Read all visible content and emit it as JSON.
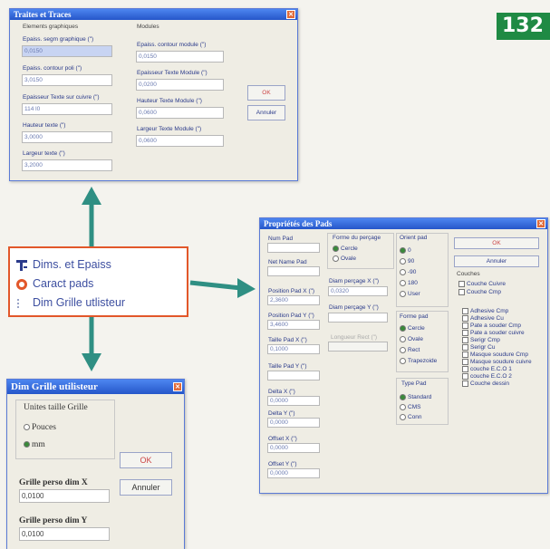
{
  "page_number": "132",
  "colors": {
    "arrow": "#2f8f83",
    "menu_border": "#e2572a",
    "accent_green": "#1f8a44",
    "title_blue": "#2b5fd6"
  },
  "menu": {
    "items": [
      {
        "icon": "tool-icon",
        "label": "Dims. et Epaiss"
      },
      {
        "icon": "target-icon",
        "label": "Caract pads"
      },
      {
        "icon": "grid-icon",
        "label": "Dim Grille utlisteur"
      }
    ]
  },
  "win_epaisseurs": {
    "title": "Traites et Traces",
    "group_left": "Elements graphiques",
    "group_right": "Modules",
    "fields_left": [
      {
        "label": "Epaiss. segm graphique (\")",
        "value": "0,0150"
      },
      {
        "label": "Epaiss. contour poli (\")",
        "value": "3,0150"
      },
      {
        "label": "Epaisseur Texte sur cuivre (\")",
        "value": "114 l0"
      },
      {
        "label": "Hauteur texte (\")",
        "value": "3,0000"
      },
      {
        "label": "Largeur texte (\")",
        "value": "3,2000"
      }
    ],
    "fields_right": [
      {
        "label": "Epaiss. contour module (\")",
        "value": "0,0150"
      },
      {
        "label": "Epaisseur Texte Module (\")",
        "value": "0,0200"
      },
      {
        "label": "Hauteur Texte Module (\")",
        "value": "0,0600"
      },
      {
        "label": "Largeur Texte Module (\")",
        "value": "0,0600"
      }
    ],
    "ok": "OK",
    "cancel": "Annuler"
  },
  "win_pads": {
    "title": "Propriétés des Pads",
    "col1_labels": [
      "Num Pad",
      "Net Name Pad",
      "Position Pad X (\")",
      "Position Pad Y (\")",
      "Taille Pad X (\")",
      "Taille Pad Y (\")",
      "Delta X (\")",
      "Delta Y (\")",
      "Offset X (\")",
      "Offset Y (\")"
    ],
    "col1_values": [
      "",
      "",
      "2,3600",
      "3,4600",
      "0,1000",
      "",
      "0,0000",
      "0,0000",
      "0,0000",
      "0,0000"
    ],
    "forme_trou_title": "Forme du perçage",
    "forme_trou_opts": [
      "Cercle",
      "Ovale"
    ],
    "diam_percage_label": "Diam perçage X (\")",
    "diam_percage_value": "0,0320",
    "diam_percage_y_label": "Diam perçage Y (\")",
    "diam_percage_y_value": "",
    "long_label": "Longueur Rect (\")",
    "orient_title": "Orient pad",
    "orient_opts": [
      "0",
      "90",
      "-90",
      "180",
      "User"
    ],
    "forme_pad_title": "Forme pad",
    "forme_pad_opts": [
      "Cercle",
      "Ovale",
      "Rect",
      "Trapezoide"
    ],
    "type_pad_title": "Type Pad",
    "type_pad_opts": [
      "Standard",
      "CMS",
      "Conn"
    ],
    "ok": "OK",
    "cancel": "Annuler",
    "couches_title": "Couches",
    "couches_main": [
      "Couche Cuivre",
      "Couche Cmp"
    ],
    "couches_list": [
      "Adhesive Cmp",
      "Adhesive Cu",
      "Pate a souder Cmp",
      "Pate a souder cuivre",
      "Serigr Cmp",
      "Serigr Cu",
      "Masque soudure Cmp",
      "Masque soudure cuivre",
      "couche E.C.O 1",
      "couche E.C.O 2",
      "Couche dessin"
    ]
  },
  "win_grille": {
    "title": "Dim Grille utilisteur",
    "units_title": "Unites taille Grille",
    "units_opts": [
      "Pouces",
      "mm"
    ],
    "ok": "OK",
    "cancel": "Annuler",
    "x_label": "Grille perso dim X",
    "x_value": "0,0100",
    "y_label": "Grille perso dim Y",
    "y_value": "0,0100"
  }
}
